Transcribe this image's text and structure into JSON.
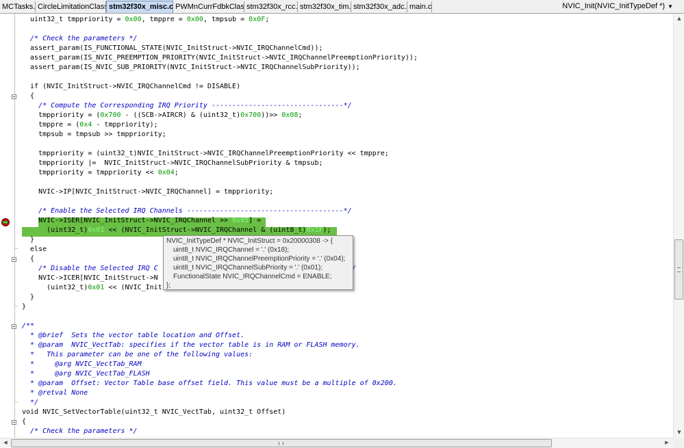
{
  "tabs": [
    {
      "label": "MCTasks.c",
      "active": false
    },
    {
      "label": "CircleLimitationClass.c",
      "active": false
    },
    {
      "label": "stm32f30x_misc.c",
      "active": true
    },
    {
      "label": "PWMnCurrFdbkClass.c",
      "active": false
    },
    {
      "label": "stm32f30x_rcc.c",
      "active": false
    },
    {
      "label": "stm32f30x_tim.c",
      "active": false
    },
    {
      "label": "stm32f30x_adc.c",
      "active": false
    },
    {
      "label": "main.c",
      "active": false
    }
  ],
  "function_dropdown": {
    "label": "NVIC_Init(NVIC_InitTypeDef *)"
  },
  "colors": {
    "comment": "#0000c0",
    "number": "#009900",
    "current_line_highlight": "#6abf45",
    "breakpoint": "#cc0000"
  },
  "code": {
    "l0": {
      "a": "  uint32_t tmppriority = ",
      "n1": "0x00",
      "b": ", tmppre = ",
      "n2": "0x00",
      "c": ", tmpsub = ",
      "n3": "0x0F",
      "d": ";"
    },
    "l2": "  /* Check the parameters */",
    "l3": "  assert_param(IS_FUNCTIONAL_STATE(NVIC_InitStruct->NVIC_IRQChannelCmd));",
    "l4": "  assert_param(IS_NVIC_PREEMPTION_PRIORITY(NVIC_InitStruct->NVIC_IRQChannelPreemptionPriority));",
    "l5": "  assert_param(IS_NVIC_SUB_PRIORITY(NVIC_InitStruct->NVIC_IRQChannelSubPriority));",
    "l7": "  if (NVIC_InitStruct->NVIC_IRQChannelCmd != DISABLE)",
    "l8": "  {",
    "l9": "    /* Compute the Corresponding IRQ Priority --------------------------------*/",
    "l10": {
      "a": "    tmppriority = (",
      "n1": "0x700",
      "b": " - ((SCB->AIRCR) & (uint32_t)",
      "n2": "0x700",
      "c": "))>> ",
      "n3": "0x08",
      "d": ";"
    },
    "l11": {
      "a": "    tmppre = (",
      "n1": "0x4",
      "b": " - tmppriority);"
    },
    "l12": "    tmpsub = tmpsub >> tmppriority;",
    "l14": "    tmppriority = (uint32_t)NVIC_InitStruct->NVIC_IRQChannelPreemptionPriority << tmppre;",
    "l15": "    tmppriority |=  NVIC_InitStruct->NVIC_IRQChannelSubPriority & tmpsub;",
    "l16": {
      "a": "    tmppriority = tmppriority << ",
      "n1": "0x04",
      "b": ";"
    },
    "l18": "    NVIC->IP[NVIC_InitStruct->NVIC_IRQChannel] = tmppriority;",
    "l20": "    /* Enable the Selected IRQ Channels --------------------------------------*/",
    "l21": {
      "a": "    NVIC->ISER[NVIC_InitStruct->NVIC_IRQChannel >> ",
      "n1": "0x05",
      "b": "] ="
    },
    "l22": {
      "a": "      (uint32_t)",
      "n1": "0x01",
      "b": " << (NVIC_InitStruct->NVIC_IRQChannel & (uint8_t)",
      "n2": "0x1F",
      "c": ");"
    },
    "l23": "  }",
    "l24": "  else",
    "l25": "  {",
    "l26": "    /* Disable the Selected IRQ C",
    "l26b": "-*/",
    "l27": "    NVIC->ICER[NVIC_InitStruct->N",
    "l28": {
      "a": "      (uint32_t)",
      "n1": "0x01",
      "b": " << (NVIC_Init"
    },
    "l29": "  }",
    "l30": "}",
    "l32": "/**",
    "l33": "  * @brief  Sets the vector table location and Offset.",
    "l34": "  * @param  NVIC_VectTab: specifies if the vector table is in RAM or FLASH memory.",
    "l35": "  *   This parameter can be one of the following values:",
    "l36": "  *     @arg NVIC_VectTab_RAM",
    "l37": "  *     @arg NVIC_VectTab_FLASH",
    "l38": "  * @param  Offset: Vector Table base offset field. This value must be a multiple of 0x200.",
    "l39": "  * @retval None",
    "l40": "  */",
    "l41": "void NVIC_SetVectorTable(uint32_t NVIC_VectTab, uint32_t Offset)",
    "l42": "{",
    "l43": "  /* Check the parameters */"
  },
  "tooltip": {
    "line1": "NVIC_InitTypeDef * NVIC_InitStruct = 0x20000308 -> {",
    "line2": "uint8_t NVIC_IRQChannel = '.' (0x18);",
    "line3": "uint8_t NVIC_IRQChannelPreemptionPriority = '.' (0x04);",
    "line4": "uint8_t NVIC_IRQChannelSubPriority = '.' (0x01);",
    "line5": "FunctionalState NVIC_IRQChannelCmd = ENABLE;",
    "line6": "};"
  },
  "icons": {
    "breakpoint": "breakpoint-current-line-icon",
    "fold": "fold-collapse-icon"
  }
}
